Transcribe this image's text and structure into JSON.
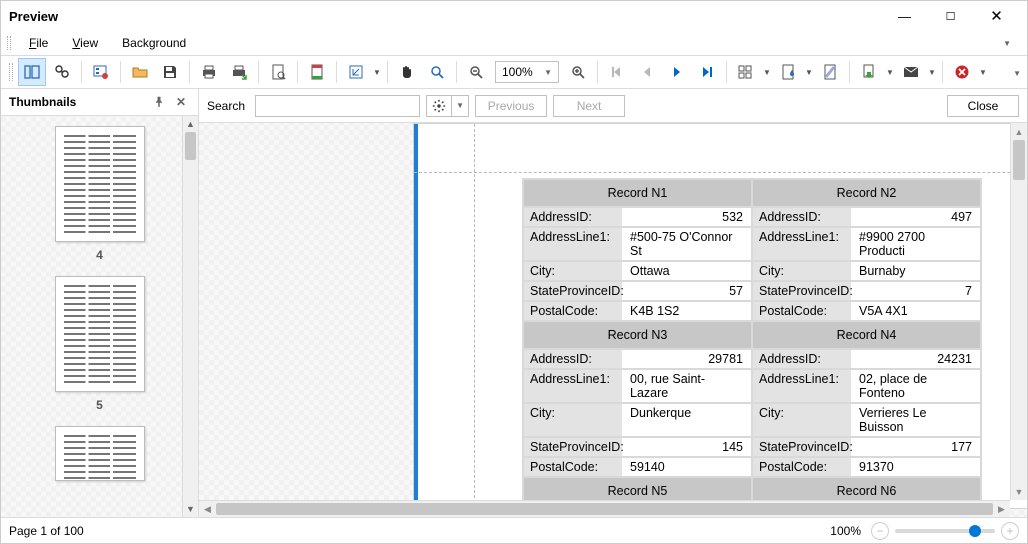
{
  "window": {
    "title": "Preview"
  },
  "menu": {
    "file": "File",
    "view": "View",
    "background": "Background"
  },
  "toolbar": {
    "zoom_value": "100%"
  },
  "sidebar": {
    "title": "Thumbnails",
    "thumbs": [
      {
        "label": "4"
      },
      {
        "label": "5"
      }
    ]
  },
  "searchbar": {
    "label": "Search",
    "value": "",
    "previous": "Previous",
    "next": "Next",
    "close": "Close"
  },
  "labels": {
    "addressId": "AddressID:",
    "addressLine1": "AddressLine1:",
    "city": "City:",
    "stateProvinceId": "StateProvinceID:",
    "postalCode": "PostalCode:"
  },
  "chart_data": {
    "type": "table",
    "records": [
      {
        "header": "Record N1",
        "addressId": 532,
        "addressLine1": "#500-75 O'Connor St",
        "city": "Ottawa",
        "stateProvinceId": 57,
        "postalCode": "K4B 1S2"
      },
      {
        "header": "Record N2",
        "addressId": 497,
        "addressLine1": "#9900 2700 Producti",
        "city": "Burnaby",
        "stateProvinceId": 7,
        "postalCode": "V5A 4X1"
      },
      {
        "header": "Record N3",
        "addressId": 29781,
        "addressLine1": "00, rue Saint-Lazare",
        "city": "Dunkerque",
        "stateProvinceId": 145,
        "postalCode": "59140"
      },
      {
        "header": "Record N4",
        "addressId": 24231,
        "addressLine1": "02, place de Fonteno",
        "city": "Verrieres Le Buisson",
        "stateProvinceId": 177,
        "postalCode": "91370"
      },
      {
        "header": "Record N5"
      },
      {
        "header": "Record N6"
      }
    ]
  },
  "status": {
    "page_info": "Page 1 of 100",
    "zoom": "100%"
  }
}
